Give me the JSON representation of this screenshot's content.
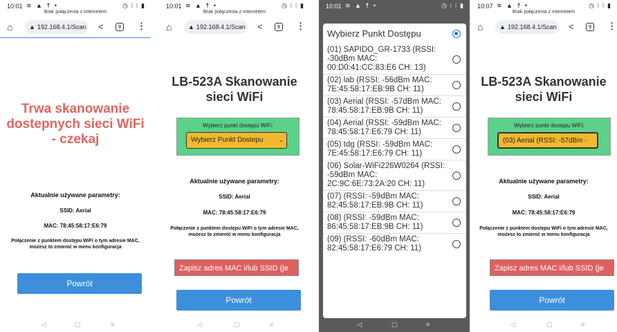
{
  "status": {
    "screen1_time": "10:01",
    "screen2_time": "10:01",
    "screen3_time": "10:01",
    "screen4_time": "10:07",
    "left_icons": "≋ ▲ ☨ •",
    "right_icons": "◷ ⁝ ⁝ ▮",
    "no_connection": "Brak połączenia z internetem"
  },
  "browser": {
    "url": "192.168.4.1/Scan",
    "tab_count": "9",
    "warning_icon": "warning-icon",
    "home_icon": "home-icon",
    "share_icon": "share-icon",
    "menu_icon": "more-vert-icon"
  },
  "screen1": {
    "scanning_text": "Trwa skanowanie dostepnych sieci WiFi - czekaj",
    "params_title": "Aktualnie używane parametry:",
    "ssid": "SSID: Aerial",
    "mac": "MAC: 78:45:58:17:E6:79",
    "info": "Połączenie z punktem dostępu WiFi o tym adresie MAC, możesz to zmienić w menu konfiguracja",
    "back_button": "Powrót"
  },
  "screen2": {
    "heading": "LB-523A Skanowanie sieci WiFi",
    "select_label": "Wybierz punkt dostępu WiFi:",
    "select_value": "Wybierz Punkt Dostepu",
    "params_title": "Aktualnie używane parametry:",
    "ssid": "SSID: Aerial",
    "mac": "MAC: 78:45:58:17:E6:79",
    "info": "Połączenie z punktem dostępu WiFi o tym adresie MAC, możesz to zmienić w menu konfiguracja",
    "save_button": "Zapisz adres MAC i/lub SSID (je",
    "back_button": "Powrót"
  },
  "screen3": {
    "title": "Wybierz Punkt Dostępu",
    "options": [
      "(01) SAPIDO_GR-1733 (RSSI: -30dBm MAC: 00:D0:41:CC:83:E6 CH: 13)",
      "(02) lab (RSSI: -56dBm MAC: 7E:45:58:17:EB:9B CH: 11)",
      "(03) Aerial (RSSI: -57dBm MAC: 78:45:58:17:EB:9B CH: 11)",
      "(04) Aerial (RSSI: -59dBm MAC: 78:45:58:17:E6:79 CH: 11)",
      "(05) tdg (RSSI: -59dBm MAC: 7E:45:58:17:E6:79 CH: 11)",
      "(06) Solar-WiFi226W0264 (RSSI: -59dBm MAC: 2C:9C:6E:73:2A:20 CH: 11)",
      "(07) (RSSI: -59dBm MAC: 82:45:58:17:EB:9B CH: 11)",
      "(08) (RSSI: -59dBm MAC: 86:45:58:17:EB:9B CH: 11)",
      "(09) (RSSI: -60dBm MAC: 82:45:58:17:E6:79 CH: 11)"
    ]
  },
  "screen4": {
    "heading": "LB-523A Skanowanie sieci WiFi",
    "select_label": "Wybierz punkt dostępu WiFi:",
    "select_value": "(03) Aerial (RSSI: -57dBm -",
    "params_title": "Aktualnie używane parametry:",
    "ssid": "SSID: Aerial",
    "mac": "MAC: 78:45:58:17:E6:79",
    "info": "Połączenie z punktem dostępu WiFi o tym adresie MAC, możesz to zmienić w menu konfiguracja",
    "save_button": "Zapisz adres MAC i/lub SSID (je",
    "back_button": "Powrót"
  },
  "navbar": {
    "back": "◁",
    "home": "▢",
    "recents": "≡"
  }
}
